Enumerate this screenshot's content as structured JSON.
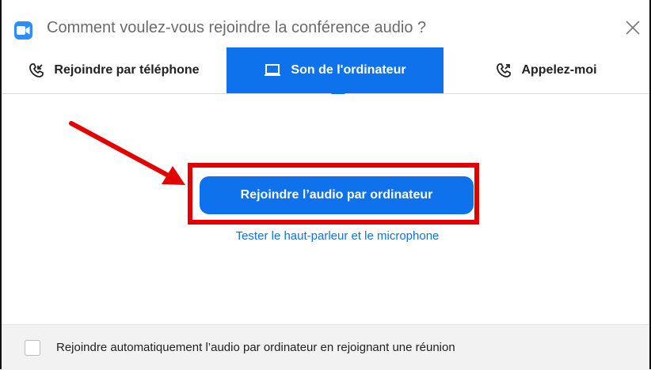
{
  "dialog": {
    "title": "Comment voulez-vous rejoindre la conférence audio ?",
    "app_icon": "zoom-camera-icon",
    "close_icon": "close-icon"
  },
  "tabs": [
    {
      "label": "Rejoindre par téléphone",
      "icon": "phone-incoming-icon",
      "active": false
    },
    {
      "label": "Son de l'ordinateur",
      "icon": "laptop-icon",
      "active": true
    },
    {
      "label": "Appelez-moi",
      "icon": "phone-outgoing-icon",
      "active": false
    }
  ],
  "main": {
    "join_button_label": "Rejoindre l’audio par ordinateur",
    "test_link_label": "Tester le haut-parleur et le microphone"
  },
  "footer": {
    "auto_join_label": "Rejoindre automatiquement l’audio par ordinateur en rejoignant une réunion",
    "auto_join_checked": false
  },
  "colors": {
    "accent": "#0E72ED",
    "annotation": "#E30000",
    "footer_bg": "#F2F2F2"
  }
}
